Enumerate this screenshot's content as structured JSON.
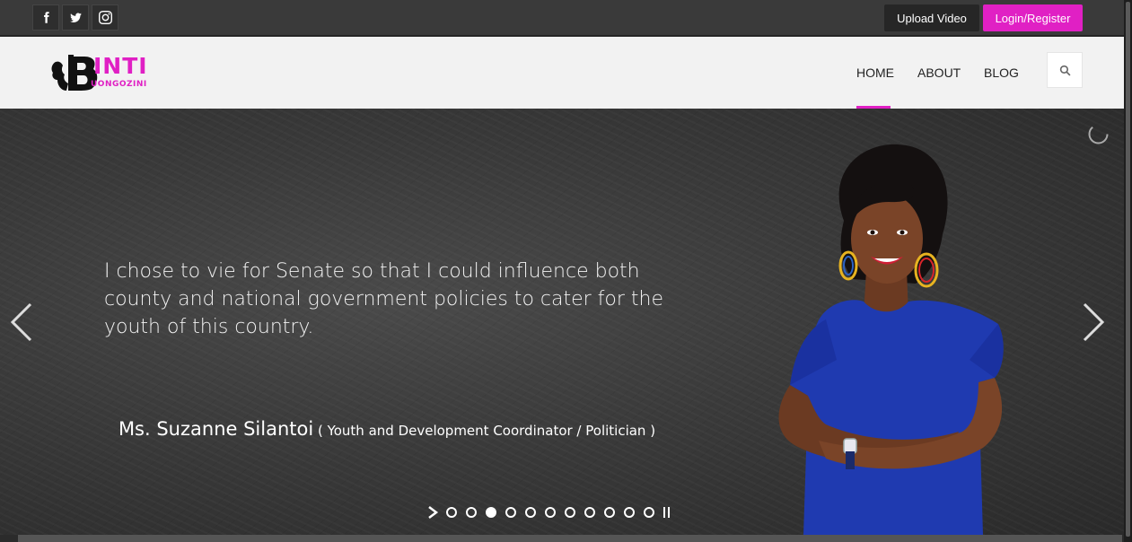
{
  "topbar": {
    "social": [
      {
        "icon": "facebook-icon"
      },
      {
        "icon": "twitter-icon"
      },
      {
        "icon": "instagram-icon"
      }
    ],
    "upload_label": "Upload Video",
    "login_label": "Login/Register"
  },
  "header": {
    "logo": {
      "main": "INTI",
      "sub": "UONGOZINI"
    },
    "nav": {
      "home": "HOME",
      "about": "ABOUT",
      "blog": "BLOG"
    },
    "search_icon": "search-icon"
  },
  "hero": {
    "quote": "I chose to vie for Senate so that I could influence both county and national government policies to cater for the youth of this country.",
    "author_name": "Ms. Suzanne Silantoi",
    "author_role": " ( Youth and Development Coordinator / Politician )",
    "slide_count": 11,
    "active_slide": 3
  },
  "colors": {
    "accent": "#e020c4",
    "topbar": "#3a3a3a",
    "header": "#f2f2f2",
    "dress": "#1f3ab0"
  }
}
